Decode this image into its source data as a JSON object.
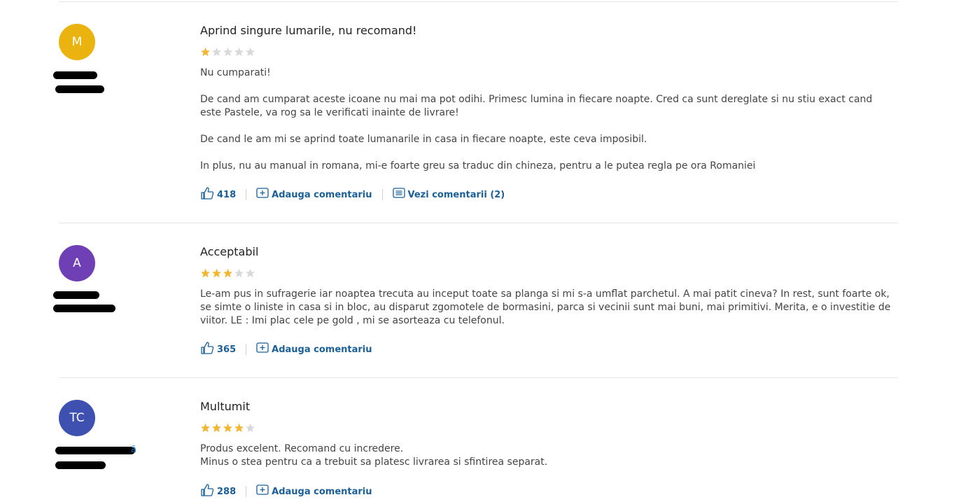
{
  "colors": {
    "star_filled": "#f2b635",
    "star_empty": "#d9d9d9",
    "action_blue": "#1a5f98"
  },
  "reviews": [
    {
      "avatar_initials": "M",
      "avatar_color": "#eab310",
      "title": "Aprind singure lumarile, nu recomand!",
      "rating": 1,
      "paragraphs": [
        "Nu cumparati!",
        "De cand am cumparat aceste icoane nu mai ma pot odihi. Primesc lumina in fiecare noapte. Cred ca sunt dereglate si nu stiu exact cand este Pastele, va rog sa le verificati inainte de livrare!",
        "De cand le am mi se aprind toate lumanarile in casa in fiecare noapte, este ceva imposibil.",
        "In plus, nu au manual in romana, mi-e foarte greu sa traduc din chineza, pentru a le putea regla pe ora Romaniei"
      ],
      "likes": "418",
      "add_comment_label": "Adauga comentariu",
      "view_comments_label": "Vezi comentarii (2)"
    },
    {
      "avatar_initials": "A",
      "avatar_color": "#6f3fb6",
      "title": "Acceptabil",
      "rating": 3,
      "paragraphs": [
        "Le-am pus in sufragerie iar noaptea trecuta au inceput toate sa planga si mi s-a umflat parchetul. A mai patit cineva? In rest, sunt foarte ok, se simte o liniste in casa si in bloc, au disparut zgomotele de bormasini, parca si vecinii sunt mai buni, mai primitivi. Merita, e o investitie de viitor. LE : Imi plac cele pe gold , mi se asorteaza cu telefonul."
      ],
      "likes": "365",
      "add_comment_label": "Adauga comentariu"
    },
    {
      "avatar_initials": "TC",
      "avatar_color": "#3f51b0",
      "user_link_tail": "ă",
      "title": "Multumit",
      "rating": 4,
      "paragraphs": [
        "Produs excelent. Recomand cu incredere.\nMinus o stea pentru ca a trebuit sa platesc livrarea si sfintirea separat."
      ],
      "likes": "288",
      "add_comment_label": "Adauga comentariu"
    }
  ]
}
